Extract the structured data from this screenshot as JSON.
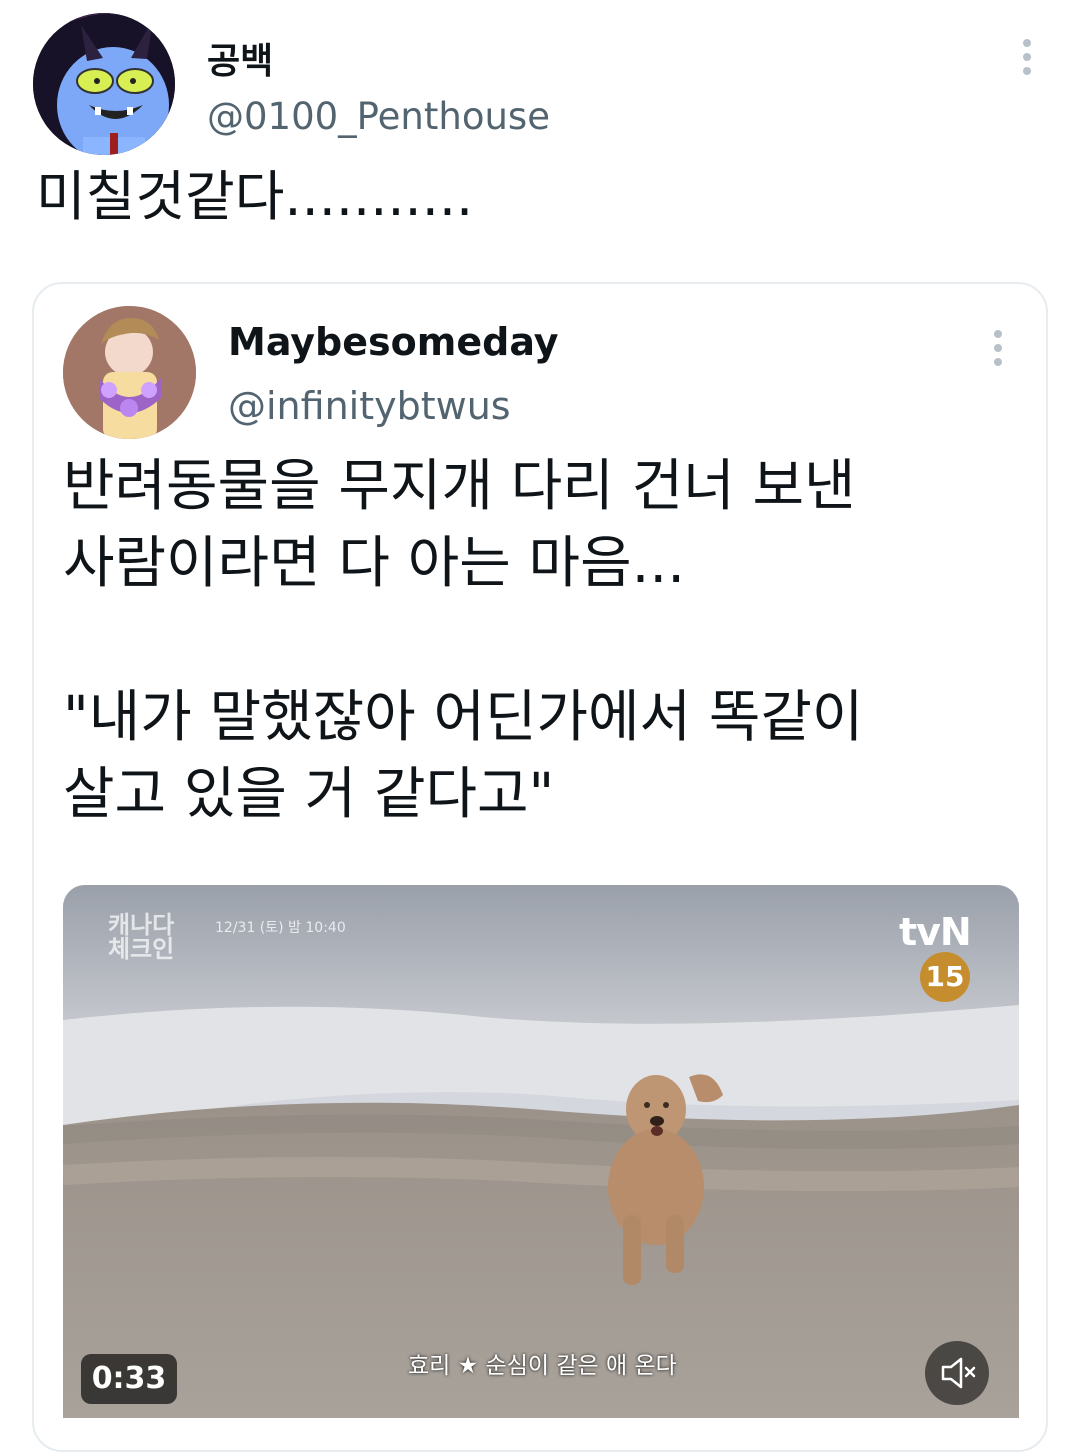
{
  "post": {
    "author_name": "공백",
    "author_handle": "@0100_Penthouse",
    "text": "미칠것같다..........."
  },
  "quoted_post": {
    "author_name": "Maybesomeday",
    "author_handle": "@infinitybtwus",
    "text": "반려동물을 무지개 다리 건너 보낸\n사람이라면 다 아는 마음...\n\n\"내가 말했잖아 어딘가에서 똑같이\n살고 있을 거 같다고\"",
    "video": {
      "duration": "0:33",
      "overlay_title": "캐나다\n체크인",
      "overlay_date": "12/31 (토) 밤 10:40",
      "channel_logo": "tvN",
      "rating": "15",
      "subtitle": "효리 ★ 순심이 같은 애 온다"
    }
  },
  "icons": {
    "more": "more-options-icon",
    "mute": "mute-icon"
  }
}
